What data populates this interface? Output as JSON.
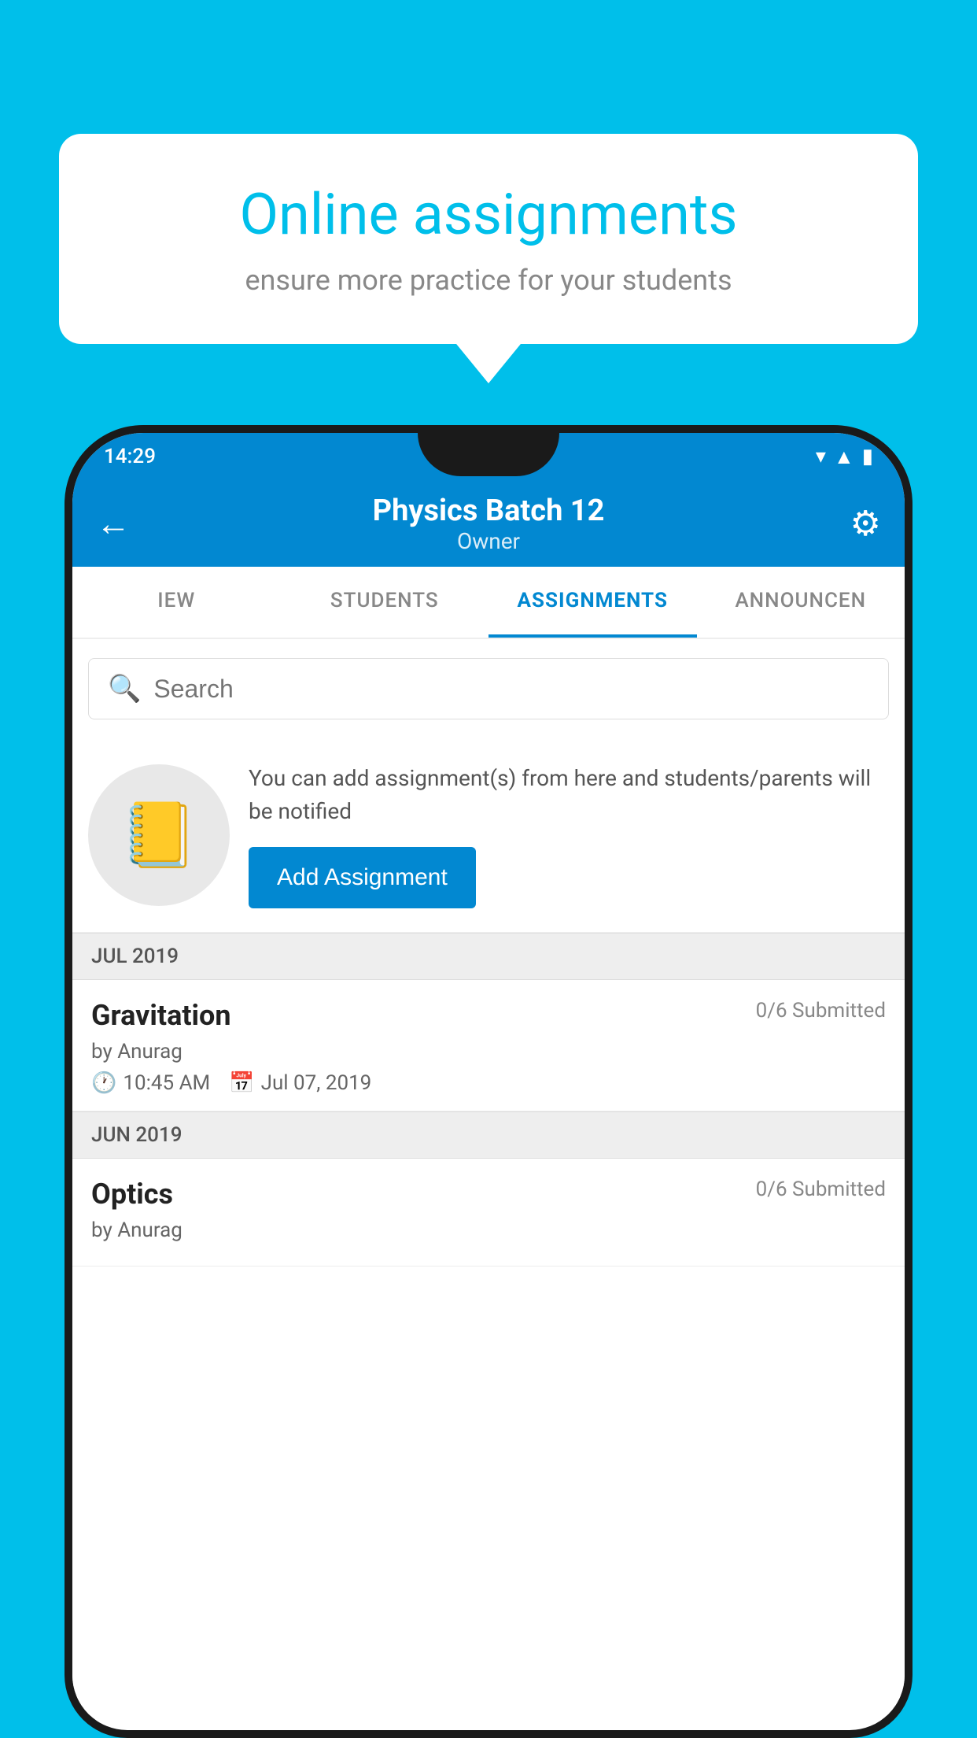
{
  "background": {
    "color": "#00BFEA"
  },
  "speech_bubble": {
    "title": "Online assignments",
    "subtitle": "ensure more practice for your students"
  },
  "status_bar": {
    "time": "14:29",
    "wifi_icon": "wifi",
    "signal_icon": "signal",
    "battery_icon": "battery"
  },
  "app_bar": {
    "back_icon": "←",
    "title": "Physics Batch 12",
    "subtitle": "Owner",
    "settings_icon": "⚙"
  },
  "tabs": [
    {
      "label": "IEW",
      "active": false
    },
    {
      "label": "STUDENTS",
      "active": false
    },
    {
      "label": "ASSIGNMENTS",
      "active": true
    },
    {
      "label": "ANNOUNCEMENTS",
      "active": false
    }
  ],
  "search": {
    "placeholder": "Search"
  },
  "empty_state": {
    "description": "You can add assignment(s) from here and students/parents will be notified",
    "button_label": "Add Assignment"
  },
  "sections": [
    {
      "month": "JUL 2019",
      "assignments": [
        {
          "title": "Gravitation",
          "submitted": "0/6 Submitted",
          "author": "by Anurag",
          "time": "10:45 AM",
          "date": "Jul 07, 2019"
        }
      ]
    },
    {
      "month": "JUN 2019",
      "assignments": [
        {
          "title": "Optics",
          "submitted": "0/6 Submitted",
          "author": "by Anurag",
          "time": "",
          "date": ""
        }
      ]
    }
  ]
}
